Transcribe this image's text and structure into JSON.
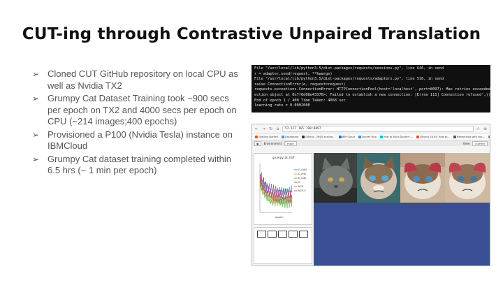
{
  "title": "CUT-ing through Contrastive Unpaired Translation",
  "bullets": [
    "Cloned CUT GitHub repository on local CPU as well as Nvidia TX2",
    "Grumpy Cat Dataset Training took ~900 secs per epoch on TX2 and 4000 secs per epoch on CPU (~214 images;400 epochs)",
    "Provisioned a P100 (Nvidia Tesla) instance on IBMCloud",
    "Grumpy Cat dataset training completed within 6.5 hrs (~ 1 min per epoch)"
  ],
  "bullet_marker": "➢",
  "terminal_lines": [
    "  File \"/usr/local/lib/python3.5/dist-packages/requests/sessions.py\", line 646, in send",
    "    r = adapter.send(request, **kwargs)",
    "  File \"/usr/local/lib/python3.5/dist-packages/requests/adapters.py\", line 516, in send",
    "    raise ConnectionError(e, request=request)",
    "requests.exceptions.ConnectionError: HTTPConnectionPool(host='localhost', port=8097): Max retries exceeded with u",
    "ection object at 0x7f6d08e43370>: Failed to establish a new connection: [Errno 111] Connection refused',))",
    "End of epoch 1 / 400      Time Taken: 4068 sec",
    "learning rate = 0.0002000"
  ],
  "browser": {
    "url": "52.117.165.190:8097",
    "bookmarks": [
      "Getting Started",
      "Dashboard",
      "GitHub - MIDS scaling...",
      "IBM Cloud",
      "Docker Hub",
      "How to Build Docker I...",
      "Ubuntu 18.04: How to...",
      "Networking with doc...",
      "models/detection_mo..."
    ],
    "visdom_env_label": "Environment",
    "visdom_env_value": "main",
    "visdom_view_label": "View",
    "visdom_view_value": "current",
    "plot_title": "grumpycat_CUT",
    "plot_xlabel": "epoch",
    "plot_legend": [
      "G_GAN",
      "D_real",
      "D_fake",
      "G",
      "NCE",
      "NCE_Y"
    ],
    "legend_colors": [
      "#1f77b4",
      "#ff7f0e",
      "#2ca02c",
      "#d62728",
      "#9467bd",
      "#8c564b"
    ]
  }
}
